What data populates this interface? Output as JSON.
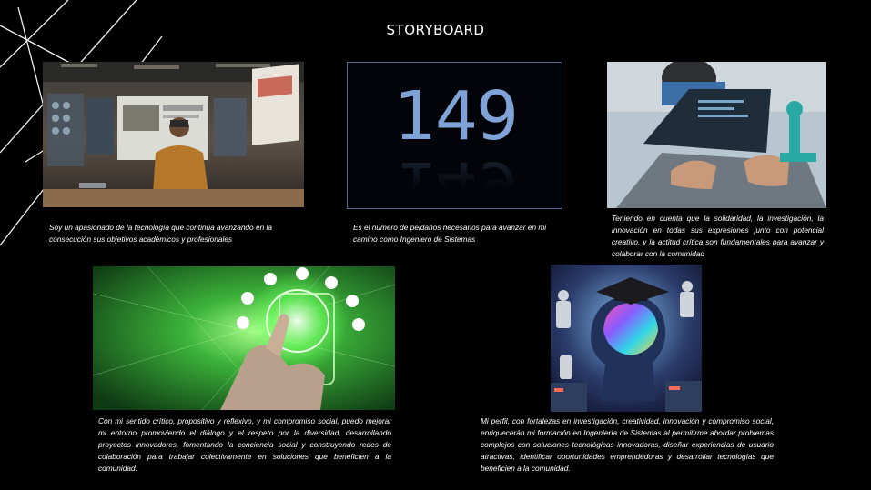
{
  "page": {
    "title": "STORYBOARD"
  },
  "cards": [
    {
      "image": "vr-workspace-photo",
      "caption": "Soy un apasionado de la tecnología que continúa avanzando en la consecución sus objetivos académicos y profesionales"
    },
    {
      "image": "number-149",
      "number": "149",
      "caption": "Es el número de peldaños necesarios para avanzar en mi camino como Ingeniero de Sistemas"
    },
    {
      "image": "hands-laptop-robotics-photo",
      "caption": "Teniendo en cuenta que la solidaridad, la investigación, la innovación en todas sus expresiones junto con potencial creativo, y la actitud crítica son fundamentales para avanzar y colaborar  con la comunidad"
    },
    {
      "image": "green-eco-hand-icons-photo",
      "caption": "Con mi sentido crítico, propositivo y reflexivo, y mi compromiso social, puedo mejorar mi entorno promoviendo el diálogo y el respeto por la diversidad, desarrollando proyectos innovadores, fomentando la conciencia social y construyendo redes de colaboración para trabajar colectivamente en soluciones que beneficien a la comunidad."
    },
    {
      "image": "graduate-head-robots-art",
      "caption": "Mi  perfil, con fortalezas en investigación, creatividad, innovación y compromiso social,  enriquecerán mi formación en Ingeniería de Sistemas al permitirme abordar problemas complejos con soluciones tecnológicas innovadoras, diseñar experiencias de usuario atractivas, identificar oportunidades emprendedoras y desarrollar tecnologías que beneficien a la comunidad."
    }
  ],
  "colors": {
    "background": "#000000",
    "text": "#ffffff",
    "number": "#7fa3d6",
    "frame": "#5a6d8e"
  }
}
